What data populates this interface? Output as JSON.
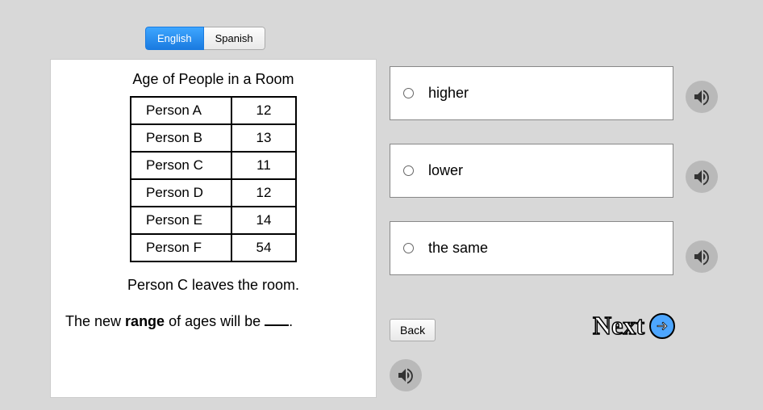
{
  "lang": {
    "english": "English",
    "spanish": "Spanish"
  },
  "question": {
    "title": "Age of People in a Room",
    "rows": [
      {
        "label": "Person A",
        "value": "12"
      },
      {
        "label": "Person B",
        "value": "13"
      },
      {
        "label": "Person C",
        "value": "11"
      },
      {
        "label": "Person D",
        "value": "12"
      },
      {
        "label": "Person E",
        "value": "14"
      },
      {
        "label": "Person F",
        "value": "54"
      }
    ],
    "line1": "Person C leaves the room.",
    "line2_pre": "The new ",
    "line2_bold": "range",
    "line2_post": " of ages will be ",
    "line2_end": "."
  },
  "answers": [
    {
      "text": "higher"
    },
    {
      "text": "lower"
    },
    {
      "text": "the same"
    }
  ],
  "nav": {
    "back": "Back",
    "next": "Next"
  }
}
